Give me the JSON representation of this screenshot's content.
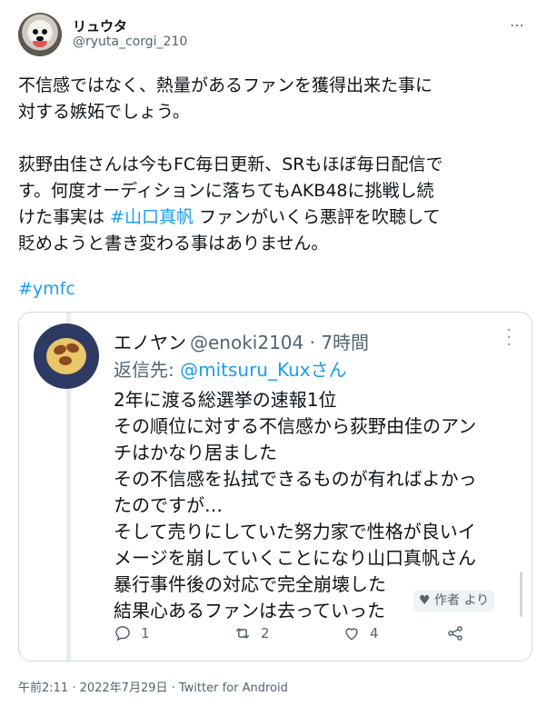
{
  "author": {
    "display_name": "リュウタ",
    "handle": "@ryuta_corgi_210"
  },
  "tweet": {
    "para1": "不信感ではなく、熱量があるファンを獲得出来た事に\n対する嫉妬でしょう。",
    "para2_a": "荻野由佳さんは今もFC毎日更新、SRもほぼ毎日配信で\nす。何度オーディションに落ちてもAKB48に挑戦し続\nけた事実は ",
    "para2_tag": "#山口真帆",
    "para2_b": " ファンがいくら悪評を吹聴して\n貶めようと書き変わる事はありません。",
    "hashtag": "#ymfc"
  },
  "quote": {
    "name": "エノヤン",
    "handle_time": "@enoki2104 · 7時間",
    "reply_label": "返信先: ",
    "reply_mention": "@mitsuru_Kuxさん",
    "text": "2年に渡る総選挙の速報1位\nその順位に対する不信感から荻野由佳のアン\nチはかなり居ました\nその不信感を払拭できるものが有ればよかっ\nたのですが…\nそして売りにしていた努力家で性格が良いイ\nメージを崩していくことになり山口真帆さん\n暴行事件後の対応で完全崩壊した\n結果心あるファンは去っていった",
    "author_pill": "♥ 作者 より",
    "replies": "1",
    "retweets": "2",
    "likes": "4"
  },
  "timestamp": "午前2:11 · 2022年7月29日 · Twitter for Android"
}
